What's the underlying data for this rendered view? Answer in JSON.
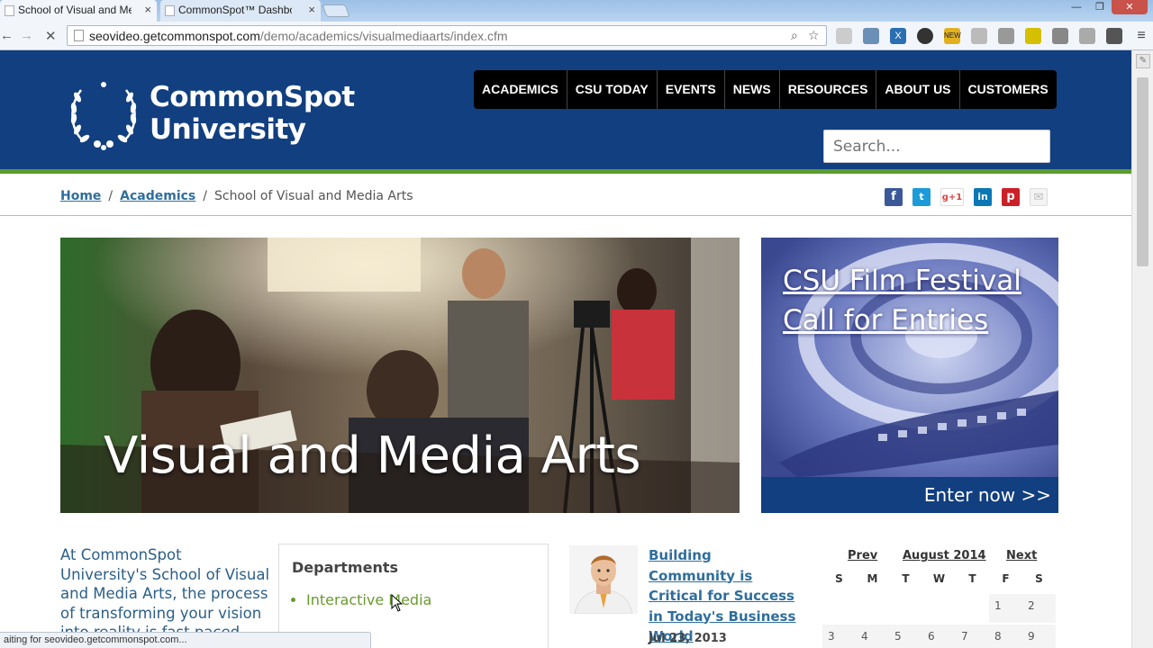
{
  "browser": {
    "tabs": [
      {
        "title": "School of Visual and Medi",
        "active": true
      },
      {
        "title": "CommonSpot™ Dashboar",
        "active": false
      }
    ],
    "url_host": "seovideo.getcommonspot.com",
    "url_path": "/demo/academics/visualmediaarts/index.cfm",
    "status_text": "aiting for seovideo.getcommonspot.com...",
    "new_badge": "NEW"
  },
  "site": {
    "logo_line1": "CommonSpot",
    "logo_line2": "University",
    "nav": [
      "ACADEMICS",
      "CSU TODAY",
      "EVENTS",
      "NEWS",
      "RESOURCES",
      "ABOUT US",
      "CUSTOMERS"
    ],
    "search_placeholder": "Search...",
    "breadcrumb": {
      "home": "Home",
      "academics": "Academics",
      "current": "School of Visual and Media Arts",
      "separator": "/"
    },
    "social": [
      "f",
      "t",
      "g+1",
      "in",
      "p",
      "✉"
    ],
    "hero_title": "Visual and Media Arts",
    "promo": {
      "title": "CSU Film Festival Call for Entries",
      "cta": "Enter now >>"
    },
    "intro": "At CommonSpot University's School of Visual and Media Arts, the process of transforming your vision into reality is fast paced, exciting",
    "departments": {
      "title": "Departments",
      "items": [
        "Interactive Media"
      ]
    },
    "news": {
      "title": "Building Community is Critical for Success in Today's Business World",
      "date": "Jul 23, 2013"
    },
    "calendar": {
      "prev": "Prev",
      "month": "August 2014",
      "next": "Next",
      "days": [
        "S",
        "M",
        "T",
        "W",
        "T",
        "F",
        "S"
      ],
      "row1": [
        "",
        "",
        "",
        "",
        "",
        "1",
        "2"
      ],
      "row2": [
        "3",
        "4",
        "5",
        "6",
        "7",
        "8",
        "9"
      ]
    }
  },
  "colors": {
    "header_blue": "#113f80",
    "accent_green": "#5c9c2f",
    "link_blue": "#2f6e9c"
  }
}
